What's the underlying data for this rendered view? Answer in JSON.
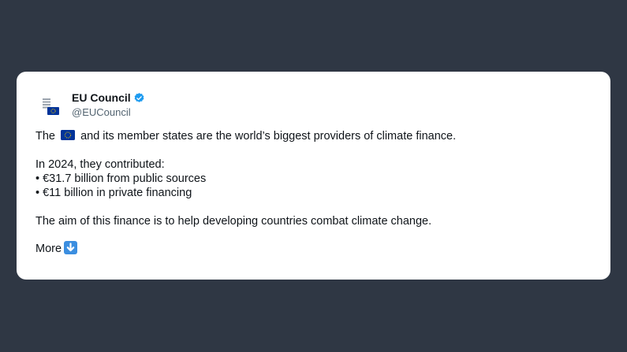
{
  "tweet": {
    "display_name": "EU Council",
    "handle": "@EUCouncil",
    "verified": true,
    "line1_before": "The",
    "line1_after": "and its member states are the world’s biggest providers of climate finance.",
    "line2": "In 2024, they contributed:",
    "bullet1": "• €31.7 billion from public sources",
    "bullet2": "• €11 billion in private financing",
    "line3": "The aim of this finance is to help developing countries combat climate change.",
    "more_label": "More"
  },
  "icons": {
    "avatar": "eu-council-logo-icon",
    "verified": "verified-badge-icon",
    "flag": "eu-flag-icon",
    "more": "down-arrow-icon"
  },
  "colors": {
    "background": "#2f3744",
    "card": "#ffffff",
    "text": "#0f1419",
    "handle": "#536471",
    "verified": "#1d9bf0",
    "eu_blue": "#003399",
    "arrow_button": "#3b8ee0"
  }
}
